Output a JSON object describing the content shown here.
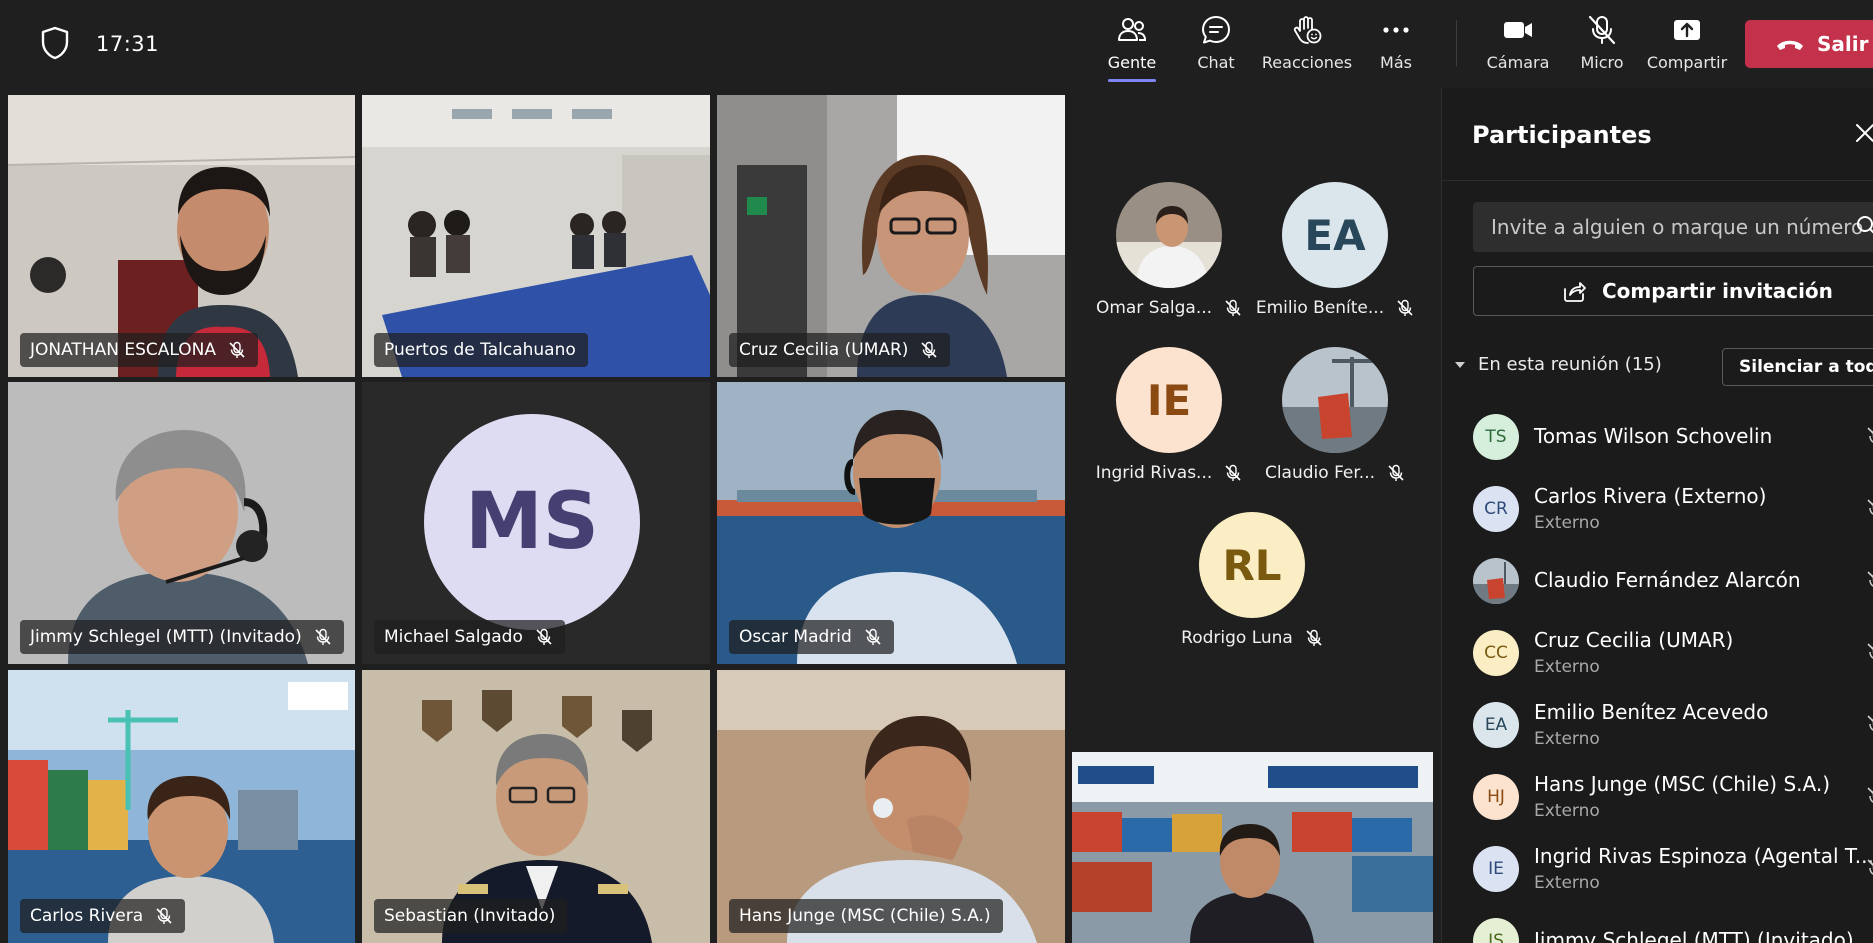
{
  "header": {
    "time": "17:31",
    "tools": [
      {
        "label": "Gente",
        "icon": "people-icon"
      },
      {
        "label": "Chat",
        "icon": "chat-icon"
      },
      {
        "label": "Reacciones",
        "icon": "reactions-icon"
      },
      {
        "label": "Más",
        "icon": "more-icon"
      },
      {
        "label": "Cámara",
        "icon": "camera-icon"
      },
      {
        "label": "Micro",
        "icon": "mic-off-icon"
      },
      {
        "label": "Compartir",
        "icon": "share-screen-icon"
      }
    ],
    "leave_label": "Salir",
    "accent_color": "#7f85f5",
    "leave_color": "#c4314b"
  },
  "grid": {
    "tiles": [
      {
        "name": "JONATHAN ESCALONA"
      },
      {
        "name": "Puertos de Talcahuano"
      },
      {
        "name": "Cruz Cecilia (UMAR)"
      },
      {
        "name": "Jimmy Schlegel (MTT) (Invitado)"
      },
      {
        "name": "Michael Salgado",
        "initials": "MS"
      },
      {
        "name": "Oscar Madrid"
      },
      {
        "name": "Carlos Rivera"
      },
      {
        "name": "Sebastian (Invitado)"
      },
      {
        "name": "Hans Junge (MSC (Chile) S.A.)"
      }
    ],
    "roster": [
      {
        "name": "Omar Salga..."
      },
      {
        "name": "Emilio Beníte...",
        "initials": "EA"
      },
      {
        "name": "Ingrid Rivas...",
        "initials": "IE"
      },
      {
        "name": "Claudio Fer..."
      },
      {
        "name": "Rodrigo Luna",
        "initials": "RL"
      }
    ]
  },
  "panel": {
    "title": "Participantes",
    "invite_placeholder": "Invite a alguien o marque un número",
    "share_label": "Compartir invitación",
    "section_label": "En esta reunión (15)",
    "mute_all_label": "Silenciar a todos",
    "participants": [
      {
        "initials": "TS",
        "name": "Tomas Wilson Schovelin",
        "sub": ""
      },
      {
        "initials": "CR",
        "name": "Carlos Rivera (Externo)",
        "sub": "Externo"
      },
      {
        "initials": "",
        "name": "Claudio Fernández Alarcón",
        "sub": ""
      },
      {
        "initials": "CC",
        "name": "Cruz Cecilia (UMAR)",
        "sub": "Externo"
      },
      {
        "initials": "EA",
        "name": "Emilio Benítez Acevedo",
        "sub": "Externo"
      },
      {
        "initials": "HJ",
        "name": "Hans Junge (MSC (Chile) S.A.)",
        "sub": "Externo"
      },
      {
        "initials": "IE",
        "name": "Ingrid Rivas Espinoza (Agental T...",
        "sub": "Externo"
      },
      {
        "initials": "JS",
        "name": "Jimmy Schlegel (MTT) (Invitado)",
        "sub": ""
      }
    ]
  }
}
